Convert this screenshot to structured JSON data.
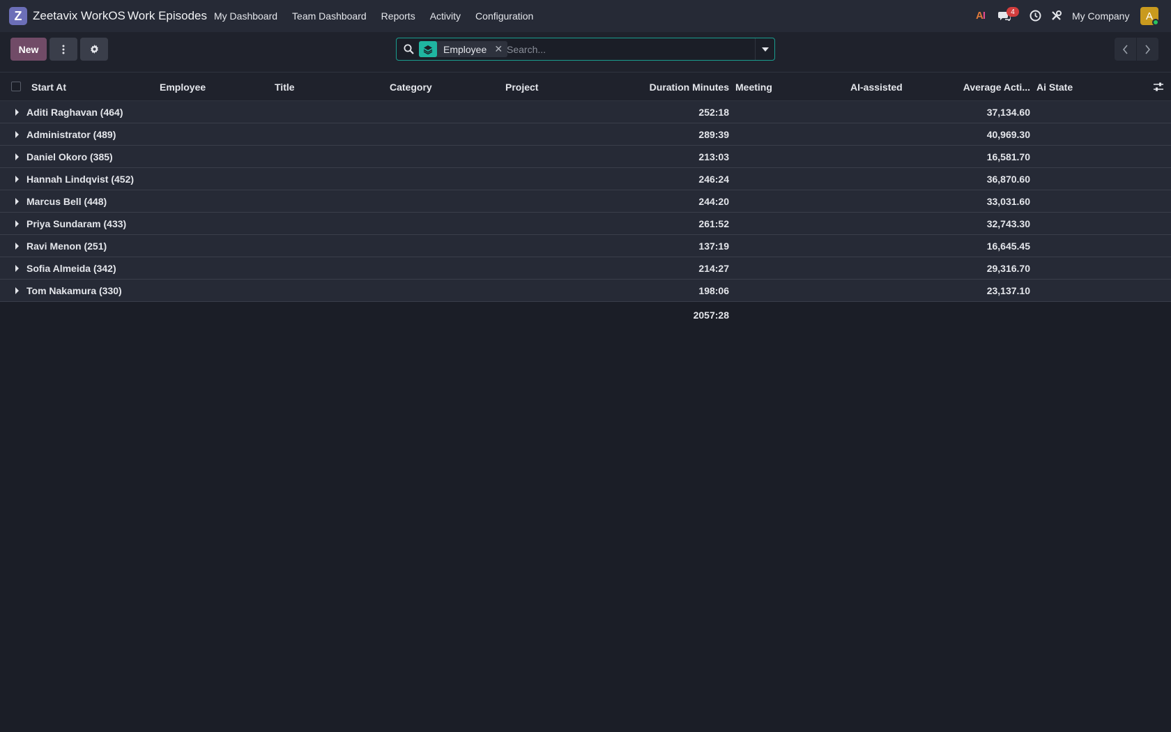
{
  "navbar": {
    "logo_letter": "Z",
    "brand": "Zeetavix WorkOS",
    "app_title": "Work Episodes",
    "menu": [
      "My Dashboard",
      "Team Dashboard",
      "Reports",
      "Activity",
      "Configuration"
    ],
    "ai_label_a": "A",
    "ai_label_i": "I",
    "chat_badge": "4",
    "company": "My Company",
    "avatar_letter": "A"
  },
  "control_panel": {
    "new_label": "New",
    "search": {
      "facet_label": "Employee",
      "placeholder": "Search..."
    }
  },
  "table": {
    "columns": [
      "Start At",
      "Employee",
      "Title",
      "Category",
      "Project",
      "Duration Minutes",
      "Meeting",
      "AI-assisted",
      "Average Acti...",
      "Ai State"
    ],
    "groups": [
      {
        "name": "Aditi Raghavan (464)",
        "duration": "252:18",
        "avg": "37,134.60"
      },
      {
        "name": "Administrator (489)",
        "duration": "289:39",
        "avg": "40,969.30"
      },
      {
        "name": "Daniel Okoro (385)",
        "duration": "213:03",
        "avg": "16,581.70"
      },
      {
        "name": "Hannah Lindqvist (452)",
        "duration": "246:24",
        "avg": "36,870.60"
      },
      {
        "name": "Marcus Bell (448)",
        "duration": "244:20",
        "avg": "33,031.60"
      },
      {
        "name": "Priya Sundaram (433)",
        "duration": "261:52",
        "avg": "32,743.30"
      },
      {
        "name": "Ravi Menon (251)",
        "duration": "137:19",
        "avg": "16,645.45"
      },
      {
        "name": "Sofia Almeida (342)",
        "duration": "214:27",
        "avg": "29,316.70"
      },
      {
        "name": "Tom Nakamura (330)",
        "duration": "198:06",
        "avg": "23,137.10"
      }
    ],
    "total_duration": "2057:28"
  },
  "colors": {
    "accent": "#714b67",
    "search_border": "#1a9e8f",
    "facet": "#1fb5a1",
    "badge": "#d23d3d",
    "avatar": "#c99a1e"
  }
}
